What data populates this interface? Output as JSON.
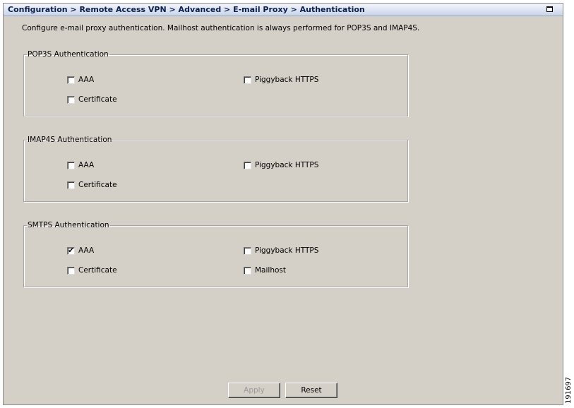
{
  "titlebar": {
    "title": "Configuration > Remote Access VPN > Advanced > E-mail Proxy > Authentication"
  },
  "description": "Configure e-mail proxy authentication. Mailhost authentication is always performed for POP3S and IMAP4S.",
  "groups": [
    {
      "legend": "POP3S Authentication",
      "options": [
        {
          "label": "AAA",
          "checked": false
        },
        {
          "label": "Piggyback HTTPS",
          "checked": false
        },
        {
          "label": "Certificate",
          "checked": false
        }
      ]
    },
    {
      "legend": "IMAP4S Authentication",
      "options": [
        {
          "label": "AAA",
          "checked": false
        },
        {
          "label": "Piggyback HTTPS",
          "checked": false
        },
        {
          "label": "Certificate",
          "checked": false
        }
      ]
    },
    {
      "legend": "SMTPS Authentication",
      "options": [
        {
          "label": "AAA",
          "checked": true
        },
        {
          "label": "Piggyback HTTPS",
          "checked": false
        },
        {
          "label": "Certificate",
          "checked": false
        },
        {
          "label": "Mailhost",
          "checked": false
        }
      ]
    }
  ],
  "buttons": {
    "apply_label": "Apply",
    "apply_enabled": false,
    "reset_label": "Reset"
  },
  "figure_id": "191697",
  "icons": {
    "maximize": "maximize-icon",
    "check": "checkmark-icon"
  },
  "colors": {
    "panel": "#d4d0c8",
    "title_text": "#0a1f4d"
  }
}
